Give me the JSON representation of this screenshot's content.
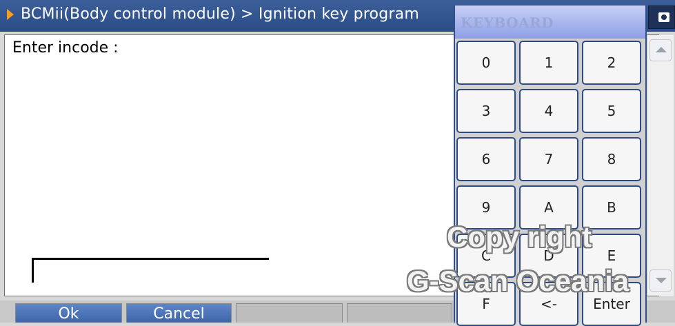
{
  "title_bar": {
    "breadcrumb": "BCMii(Body control module) > Ignition key program",
    "camera_icon": "camera-icon",
    "colors": {
      "background": "#2b4c86",
      "arrow": "#ff9d1a"
    }
  },
  "main": {
    "prompt": "Enter incode :",
    "input_value": ""
  },
  "keyboard": {
    "title": "KEYBOARD",
    "keys": [
      "0",
      "1",
      "2",
      "3",
      "4",
      "5",
      "6",
      "7",
      "8",
      "9",
      "A",
      "B",
      "C",
      "D",
      "E",
      "F",
      "<-",
      "Enter"
    ]
  },
  "footer": {
    "ok_label": "Ok",
    "cancel_label": "Cancel"
  },
  "watermark": {
    "line1": "Copy right",
    "line2": "G-Scan Oceania"
  }
}
